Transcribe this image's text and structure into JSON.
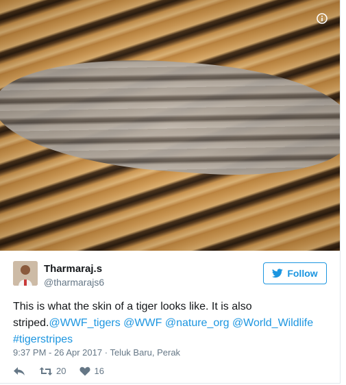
{
  "media": {
    "info_icon": "info-circle-icon",
    "description_icon": "tiger-fur-photo"
  },
  "author": {
    "display_name": "Tharmaraj.s",
    "screen_name": "@tharmarajs6",
    "avatar": "avatar-photo"
  },
  "follow": {
    "label": "Follow",
    "icon": "twitter-bird-icon",
    "color": "#1b95e0"
  },
  "tweet": {
    "text_plain": "This is what the skin of a tiger looks like. It is also striped.",
    "mentions": [
      "@WWF_tigers",
      "@WWF",
      "@nature_org",
      "@World_Wildlife"
    ],
    "hashtag": "#tigerstripes"
  },
  "meta": {
    "time": "9:37 PM - 26 Apr 2017",
    "separator": "·",
    "location": "Teluk Baru, Perak"
  },
  "actions": {
    "reply_icon": "reply-icon",
    "retweet_icon": "retweet-icon",
    "retweet_count": "20",
    "like_icon": "heart-icon",
    "like_count": "16"
  },
  "colors": {
    "link": "#1b95e0",
    "secondary_text": "#657786",
    "primary_text": "#14171a"
  }
}
